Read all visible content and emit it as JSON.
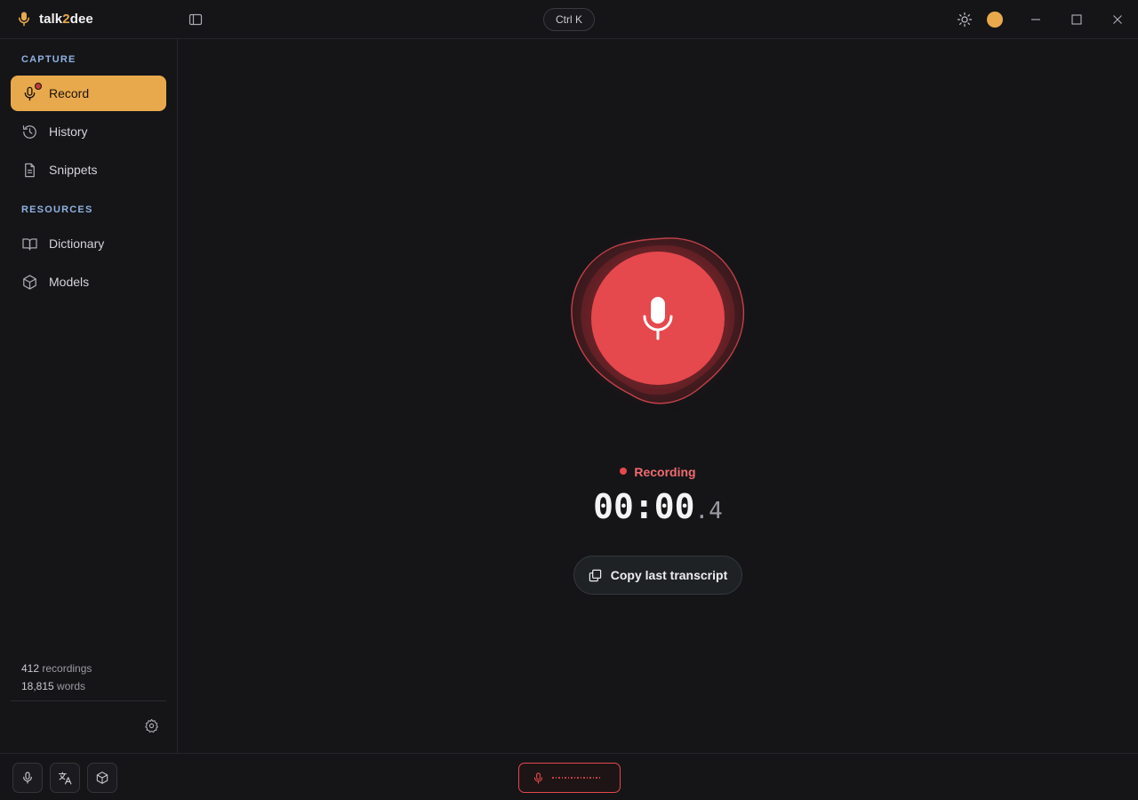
{
  "app": {
    "name_main": "talk",
    "name_accent": "2",
    "name_end": "dee",
    "shortcut_label": "Ctrl K"
  },
  "colors": {
    "accent": "#e8a94c",
    "recording": "#e5484d",
    "section_label": "#8fb1e0",
    "background": "#151518"
  },
  "sidebar": {
    "sections": [
      {
        "label": "CAPTURE",
        "items": [
          {
            "label": "Record",
            "icon": "mic-icon",
            "active": true
          },
          {
            "label": "History",
            "icon": "history-icon",
            "active": false
          },
          {
            "label": "Snippets",
            "icon": "document-icon",
            "active": false
          }
        ]
      },
      {
        "label": "RESOURCES",
        "items": [
          {
            "label": "Dictionary",
            "icon": "book-icon",
            "active": false
          },
          {
            "label": "Models",
            "icon": "cube-icon",
            "active": false
          }
        ]
      }
    ],
    "stats": {
      "recordings_count": "412",
      "recordings_label": "recordings",
      "words_count": "18,815",
      "words_label": "words"
    }
  },
  "main": {
    "status": "Recording",
    "timer_main": "00:00",
    "timer_fraction": ".4",
    "copy_button_label": "Copy last transcript"
  },
  "bottombar": {
    "buttons": [
      "mic-icon",
      "translate-icon",
      "cube-icon"
    ],
    "recording_indicator": "mic-icon"
  }
}
